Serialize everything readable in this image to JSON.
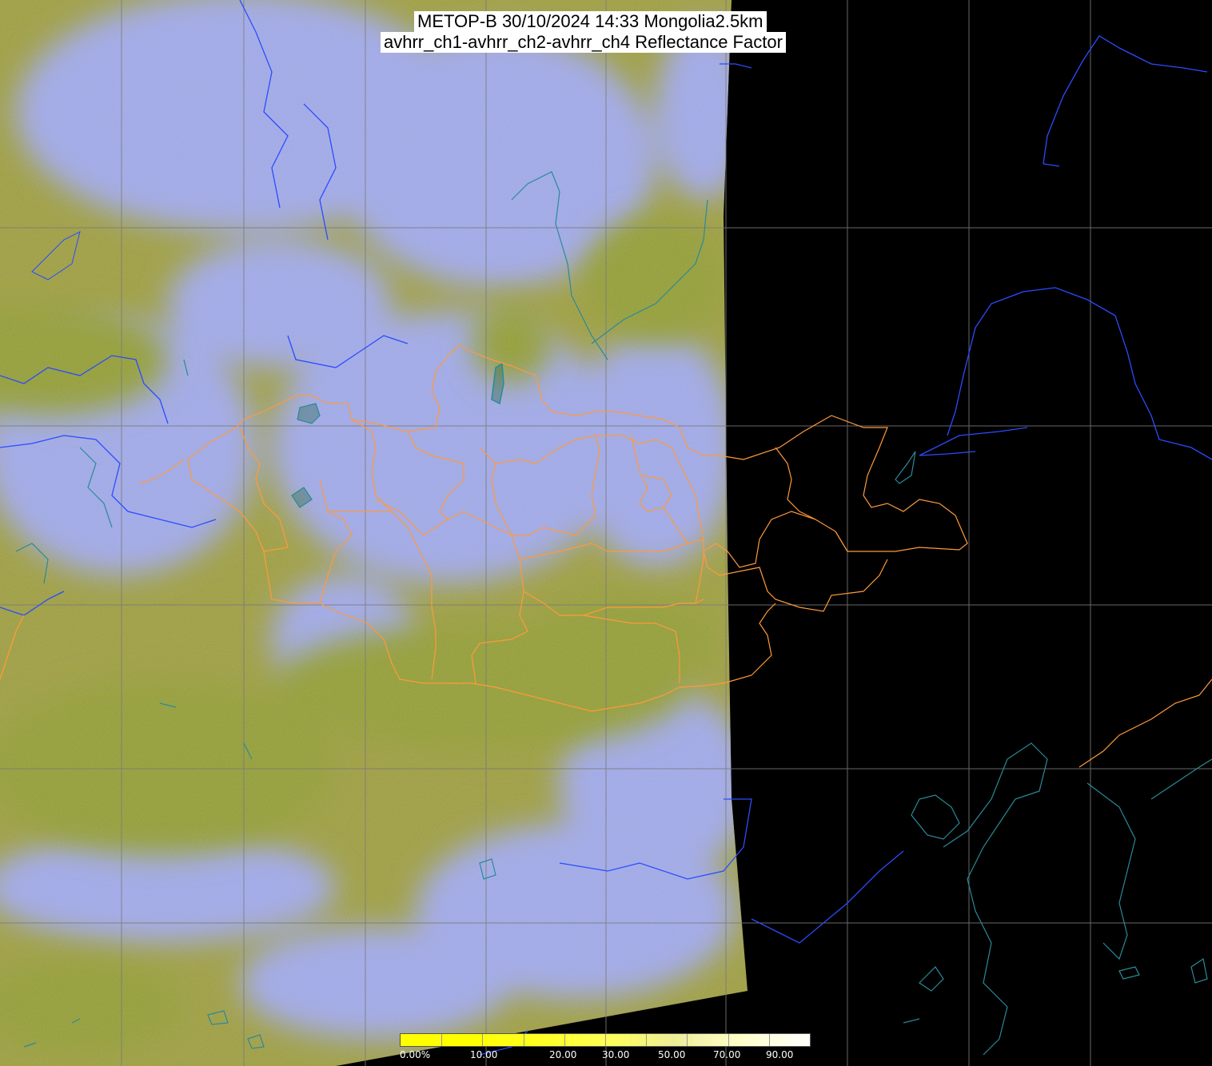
{
  "title": {
    "line1": "METOP-B 30/10/2024 14:33 Mongolia2.5km",
    "line2": "avhrr_ch1-avhrr_ch2-avhrr_ch4 Reflectance Factor"
  },
  "colorbar": {
    "labels": [
      "0.00%",
      "10.00",
      "20.00",
      "30.00",
      "50.00",
      "70.00",
      "90.00"
    ],
    "colors": [
      "#ffff00",
      "#ffff00",
      "#ffff22",
      "#ffff55",
      "#eeee99",
      "#ffffcc",
      "#ffffff"
    ]
  },
  "colors": {
    "background": "#000000",
    "clear_land": "#9a9a2a",
    "cloud": "#9aa6ee",
    "grid": "#888888",
    "country_border": "#2a4aff",
    "province_border": "#ff9a3a",
    "coastline": "#2a8a9a"
  }
}
